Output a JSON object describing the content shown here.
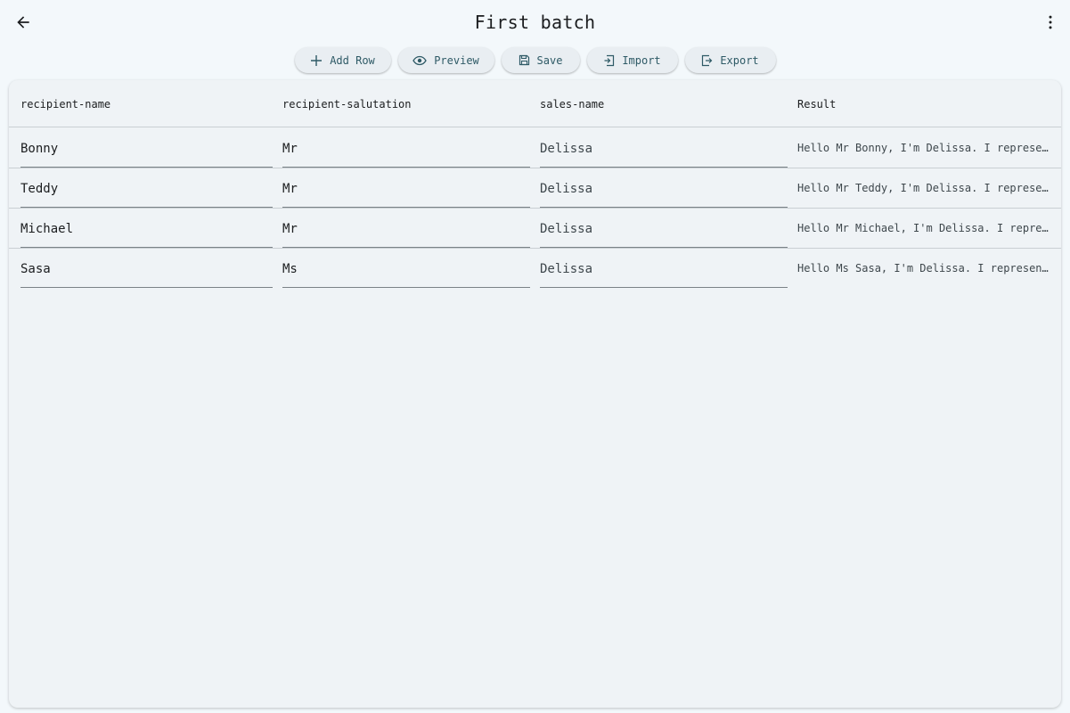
{
  "header": {
    "title": "First batch",
    "back_icon": "arrow-left-icon",
    "menu_icon": "more-vert-icon"
  },
  "toolbar": {
    "add_row": "Add Row",
    "preview": "Preview",
    "save": "Save",
    "import": "Import",
    "export": "Export"
  },
  "table": {
    "columns": [
      "recipient-name",
      "recipient-salutation",
      "sales-name",
      "Result"
    ],
    "rows": [
      {
        "name": "Bonny",
        "salutation": "Mr",
        "sales": "Delissa",
        "result": "Hello Mr Bonny, I'm Delissa. I represent…"
      },
      {
        "name": "Teddy",
        "salutation": "Mr",
        "sales": "Delissa",
        "result": "Hello Mr Teddy, I'm Delissa. I represent…"
      },
      {
        "name": "Michael",
        "salutation": "Mr",
        "sales": "Delissa",
        "result": "Hello Mr Michael, I'm Delissa. I represe…"
      },
      {
        "name": "Sasa",
        "salutation": "Ms",
        "sales": "Delissa",
        "result": "Hello Ms Sasa, I'm Delissa. I represent …"
      }
    ]
  },
  "colors": {
    "background": "#f3f8fb",
    "card": "#eff3f6",
    "button_text": "#2e5a66",
    "divider": "#c9cfd3"
  }
}
